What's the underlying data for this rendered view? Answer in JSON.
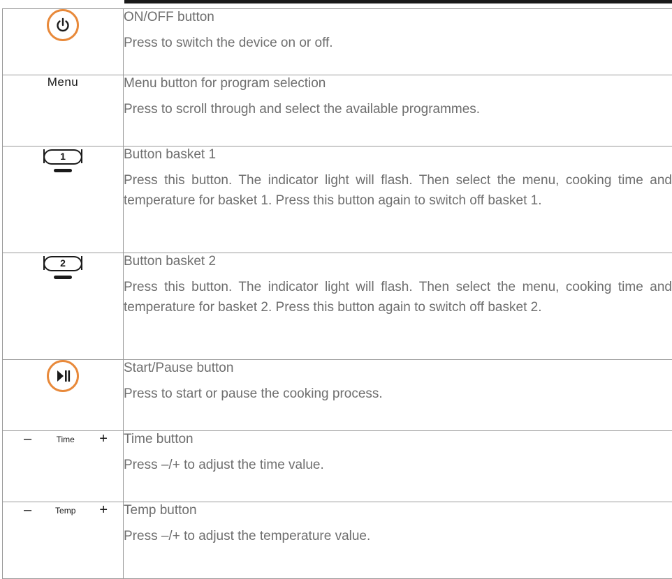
{
  "rows": [
    {
      "title": "ON/OFF button",
      "desc": "Press to switch the device on or off.",
      "icon": "power-icon",
      "accent": "#e8893a"
    },
    {
      "title": "Menu button for program selection",
      "desc": "Press to scroll through and select the available programmes.",
      "icon_label": "Menu"
    },
    {
      "title": "Button basket 1",
      "desc": "Press this button. The indicator light will flash. Then select the menu, cooking time and temperature for basket 1. Press this button again to switch off basket 1.",
      "icon_label": "1",
      "icon": "basket-1-icon"
    },
    {
      "title": "Button basket 2",
      "desc": "Press this button. The indicator light will flash. Then select the menu, cooking time and temperature for basket 2. Press this button again to switch off basket 2.",
      "icon_label": "2",
      "icon": "basket-2-icon"
    },
    {
      "title": "Start/Pause button",
      "desc": "Press to start or pause the cooking process.",
      "icon": "play-pause-icon",
      "accent": "#e8893a"
    },
    {
      "title": "Time button",
      "desc": "Press –/+ to adjust the time value.",
      "minus": "–",
      "plus": "+",
      "icon_label": "Time"
    },
    {
      "title": "Temp button",
      "desc": "Press –/+ to adjust the temperature value.",
      "minus": "–",
      "plus": "+",
      "icon_label": "Temp"
    }
  ]
}
